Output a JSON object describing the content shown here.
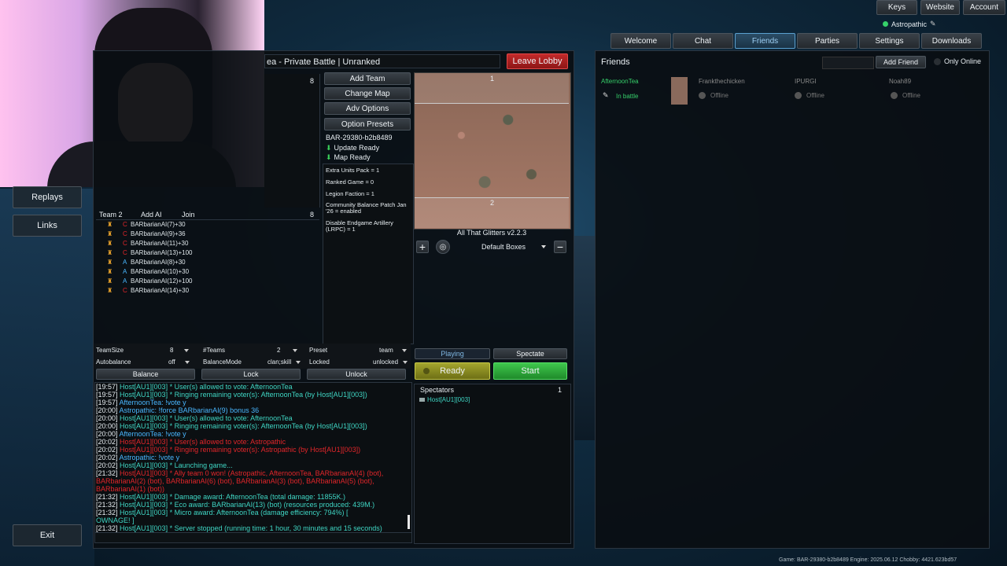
{
  "top_buttons": [
    "Keys",
    "Website",
    "Account"
  ],
  "user": {
    "name": "Astropathic",
    "status_color": "#36d06a"
  },
  "nav_tabs": [
    "Welcome",
    "Chat",
    "Friends",
    "Parties",
    "Settings",
    "Downloads"
  ],
  "active_tab": "Friends",
  "left_menu": [
    "Replays",
    "Links",
    "Exit"
  ],
  "battle": {
    "title": "ea - Private Battle | Unranked",
    "leave_label": "Leave Lobby",
    "team1_count": "8",
    "team2_label": "Team 2",
    "add_ai_label": "Add AI",
    "join_label": "Join",
    "team2_count": "8",
    "team2_players": [
      {
        "name": "BARbarianAI(7)+30",
        "faction": "cortex"
      },
      {
        "name": "BARbarianAI(9)+36",
        "faction": "cortex"
      },
      {
        "name": "BARbarianAI(11)+30",
        "faction": "cortex"
      },
      {
        "name": "BARbarianAI(13)+100",
        "faction": "cortex"
      },
      {
        "name": "BARbarianAI(8)+30",
        "faction": "armada"
      },
      {
        "name": "BARbarianAI(10)+30",
        "faction": "armada"
      },
      {
        "name": "BARbarianAI(12)+100",
        "faction": "armada"
      },
      {
        "name": "BARbarianAI(14)+30",
        "faction": "cortex"
      }
    ],
    "actions": [
      "Add Team",
      "Change Map",
      "Adv Options",
      "Option Presets"
    ],
    "build_id": "BAR-29380-b2b8489",
    "update_status": "Update Ready",
    "map_status": "Map Ready",
    "options": [
      "Extra Units Pack = 1",
      "Ranked Game = 0",
      "Legion Faction = 1",
      "Community Balance Patch Jan '26 = enabled",
      "Disable Endgame Artillery (LRPC) = 1"
    ],
    "map_label_1": "1",
    "map_label_2": "2",
    "map_name": "All That Glitters v2.2.3",
    "boxes_label": "Default Boxes",
    "settings": {
      "teamsize_label": "TeamSize",
      "teamsize_value": "8",
      "teams_label": "#Teams",
      "teams_value": "2",
      "preset_label": "Preset",
      "preset_value": "team",
      "autobalance_label": "Autobalance",
      "autobalance_value": "off",
      "balancemode_label": "BalanceMode",
      "balancemode_value": "clan;skill",
      "locked_label": "Locked",
      "locked_value": "unlocked"
    },
    "balance_label": "Balance",
    "lock_label": "Lock",
    "unlock_label": "Unlock",
    "playing_label": "Playing",
    "spectate_label": "Spectate",
    "ready_label": "Ready",
    "start_label": "Start",
    "spectators_label": "Spectators",
    "spectators_count": "1",
    "spectators": [
      "Host[AU1][003]"
    ]
  },
  "chat": [
    {
      "t": "[19:57]",
      "text": " Host[AU1][003] * User(s) allowed to vote: AfternoonTea",
      "c": "teal"
    },
    {
      "t": "[19:57]",
      "text": " Host[AU1][003] * Ringing remaining voter(s): AfternoonTea (by Host[AU1][003])",
      "c": "teal"
    },
    {
      "t": "[19:57]",
      "text": " AfternoonTea: !vote y",
      "c": "blue"
    },
    {
      "t": "[20:00]",
      "text": " Astropathic: !force BARbarianAI(9) bonus 36",
      "c": "blue"
    },
    {
      "t": "[20:00]",
      "text": " Host[AU1][003] * User(s) allowed to vote: AfternoonTea",
      "c": "teal"
    },
    {
      "t": "[20:00]",
      "text": " Host[AU1][003] * Ringing remaining voter(s): AfternoonTea (by Host[AU1][003])",
      "c": "teal"
    },
    {
      "t": "[20:00]",
      "text": " AfternoonTea: !vote y",
      "c": "blue"
    },
    {
      "t": "[20:02]",
      "text": " Host[AU1][003] * User(s) allowed to vote: Astropathic",
      "c": "red"
    },
    {
      "t": "[20:02]",
      "text": " Host[AU1][003] * Ringing remaining voter(s): Astropathic (by Host[AU1][003])",
      "c": "red"
    },
    {
      "t": "[20:02]",
      "text": " Astropathic: !vote y",
      "c": "blue"
    },
    {
      "t": "[20:02]",
      "text": " Host[AU1][003] * Launching game...",
      "c": "teal"
    },
    {
      "t": "[21:32]",
      "text": " Host[AU1][003] * Ally team 0 won! (Astropathic, AfternoonTea, BARbarianAI(4) (bot),",
      "c": "red"
    },
    {
      "t": "",
      "text": "BARbarianAI(2) (bot), BARbarianAI(6) (bot), BARbarianAI(3) (bot), BARbarianAI(5) (bot),",
      "c": "red"
    },
    {
      "t": "",
      "text": "BARbarianAI(1) (bot))",
      "c": "red"
    },
    {
      "t": "[21:32]",
      "text": " Host[AU1][003] *    Damage award:  AfternoonTea         (total damage: 11855K.)",
      "c": "teal"
    },
    {
      "t": "[21:32]",
      "text": " Host[AU1][003] *    Eco award:     BARbarianAI(13) (bot)  (resources produced: 439M.)",
      "c": "teal"
    },
    {
      "t": "[21:32]",
      "text": " Host[AU1][003] *    Micro award:   AfternoonTea          (damage efficiency: 794%)    [",
      "c": "teal"
    },
    {
      "t": "",
      "text": "OWNAGE! ]",
      "c": "teal"
    },
    {
      "t": "[21:32]",
      "text": " Host[AU1][003] * Server stopped (running time: 1 hour, 30 minutes and 15 seconds)",
      "c": "teal"
    }
  ],
  "friends": {
    "title": "Friends",
    "add_label": "Add Friend",
    "only_online_label": "Only Online",
    "entries": [
      {
        "name": "AfternoonTea",
        "status": "In battle",
        "online": true
      },
      {
        "name": "Frankthechicken",
        "status": "Offline",
        "online": false
      },
      {
        "name": "IPURGI",
        "status": "Offline",
        "online": false
      },
      {
        "name": "Noah89",
        "status": "Offline",
        "online": false
      }
    ]
  },
  "footer": "Game: BAR-29380-b2b8489  Engine: 2025.06.12  Chobby: 4421.623bd57"
}
